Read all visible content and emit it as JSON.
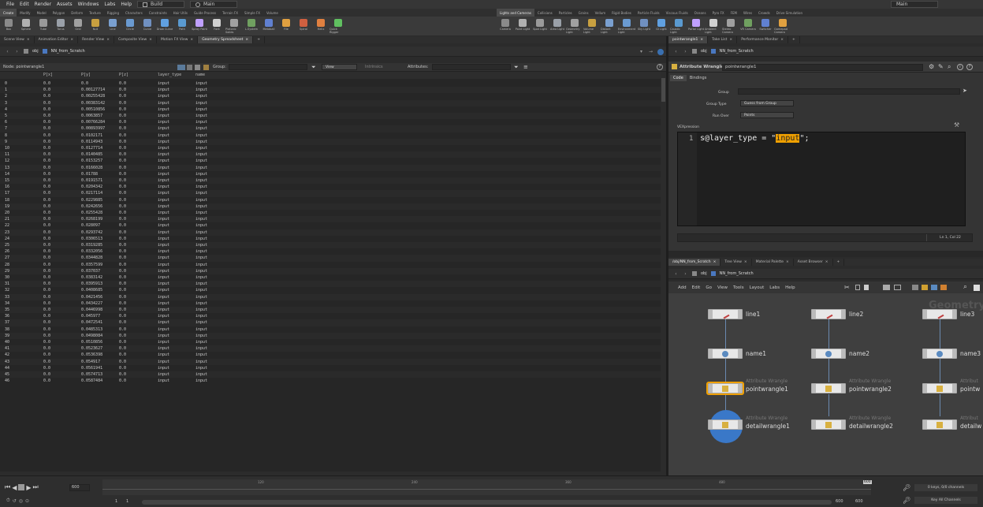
{
  "menubar": {
    "items": [
      "File",
      "Edit",
      "Render",
      "Assets",
      "Windows",
      "Labs",
      "Help"
    ],
    "desktop": "Build",
    "desktop2": "Main",
    "right_label": "Main"
  },
  "shelf_tabs_left": [
    "Create",
    "Modify",
    "Model",
    "Polygon",
    "Deform",
    "Texture",
    "Rigging",
    "Characters",
    "Constraints",
    "Hair Utils",
    "Guide Process",
    "Terrain FX",
    "Simple FX",
    "Volume"
  ],
  "shelf_tabs_right": [
    "Lights and Cameras",
    "Collisions",
    "Particles",
    "Grains",
    "Vellum",
    "Rigid Bodies",
    "Particle Fluids",
    "Viscous Fluids",
    "Oceans",
    "Pyro FX",
    "FEM",
    "Wires",
    "Crowds",
    "Drive Simulation"
  ],
  "tools_left": [
    "Box",
    "Sphere",
    "Tube",
    "Torus",
    "Grid",
    "Null",
    "Line",
    "Circle",
    "Curve",
    "Draw Curve",
    "Path",
    "Spray Paint",
    "Font",
    "Platonic Solids",
    "L-System",
    "Metaball",
    "File",
    "Spiral",
    "Helix",
    "Quick Rigger"
  ],
  "tools_right": [
    "Camera",
    "Point Light",
    "Spot Light",
    "Area Light",
    "Geometry Light",
    "Volume Light",
    "Distant Light",
    "Environment Light",
    "Sky Light",
    "GI Light",
    "Caustic Light",
    "Portal Light",
    "Ambient Light",
    "Stereo Camera",
    "VR Camera",
    "Switcher",
    "Gamepad Camera"
  ],
  "left_pane": {
    "tabs": [
      "Scene View",
      "Animation Editor",
      "Render View",
      "Composite View",
      "Motion FX View",
      "Geometry Spreadsheet"
    ],
    "path_obj": "obj",
    "path_node": "NN_from_Scratch",
    "node_label": "Node: pointwrangle1",
    "group_label": "Group:",
    "view_label": "View",
    "intrinsics_label": "Intrinsics",
    "attributes_label": "Attributes:",
    "columns": [
      "",
      "P[x]",
      "P[y]",
      "P[z]",
      "layer_type",
      "name"
    ],
    "px": "0.0",
    "pz": "0.0",
    "layer_type": "input",
    "name": "input",
    "py_values": [
      "0.0",
      "0.00127714",
      "0.00255428",
      "0.00383142",
      "0.00510856",
      "0.0063857",
      "0.00766284",
      "0.00893997",
      "0.0102171",
      "0.0114943",
      "0.0127714",
      "0.0140485",
      "0.0153257",
      "0.0166028",
      "0.01788",
      "0.0191571",
      "0.0204342",
      "0.0217114",
      "0.0229885",
      "0.0242656",
      "0.0255428",
      "0.0268199",
      "0.028097",
      "0.0293742",
      "0.0306513",
      "0.0319285",
      "0.0332056",
      "0.0344828",
      "0.0357599",
      "0.037037",
      "0.0383142",
      "0.0395913",
      "0.0408685",
      "0.0421456",
      "0.0434227",
      "0.0446998",
      "0.045977",
      "0.0472541",
      "0.0485313",
      "0.0498084",
      "0.0510856",
      "0.0523627",
      "0.0536398",
      "0.054917",
      "0.0561941",
      "0.0574713",
      "0.0587484"
    ]
  },
  "right_top": {
    "tabs": [
      "pointwrangle1",
      "Take List",
      "Performance Monitor"
    ],
    "path_obj": "obj",
    "path_node": "NN_from_Scratch",
    "node_type": "Attribute Wrangle",
    "node_name": "pointwrangle1",
    "param_tabs": [
      "Code",
      "Bindings"
    ],
    "group_label": "Group",
    "group_type_label": "Group Type",
    "group_type_value": "Guess from Group",
    "run_over_label": "Run Over",
    "run_over_value": "Points",
    "vex_label": "VEXpression",
    "code_line_no": "1",
    "code_prefix": "s@layer_type = \"",
    "code_highlight": "input",
    "code_suffix": "\";",
    "status": "Ln 1, Col 22"
  },
  "right_bottom": {
    "tabs": [
      "/obj/NN_from_Scratch",
      "Tree View",
      "Material Palette",
      "Asset Browser"
    ],
    "path_obj": "obj",
    "path_node": "NN_from_Scratch",
    "menu": [
      "Add",
      "Edit",
      "Go",
      "View",
      "Tools",
      "Layout",
      "Labs",
      "Help"
    ],
    "watermark": "Geometry",
    "nodes": {
      "line1": "line1",
      "line2": "line2",
      "line3": "line3",
      "name1": "name1",
      "name2": "name2",
      "name3": "name3",
      "pw1": "pointwrangle1",
      "pw2": "pointwrangle2",
      "pw3": "pointw",
      "dw1": "detailwrangle1",
      "dw2": "detailwrangle2",
      "dw3": "detailw",
      "aw_type": "Attribute Wrangle",
      "aw_type_short": "Attribut"
    }
  },
  "timeline": {
    "frame_field": "600",
    "ticks": [
      "120",
      "240",
      "360",
      "480",
      "600"
    ],
    "current_frame_marker": "600",
    "start": "1",
    "start2": "1",
    "end": "600",
    "end2": "600",
    "keys_label": "0 keys, 0/0 channels",
    "key_all": "Key All Channels"
  },
  "colors": {
    "accent_selected": "#f0a000",
    "node_blue": "#3a78c8",
    "wire": "#6a8ab0"
  }
}
